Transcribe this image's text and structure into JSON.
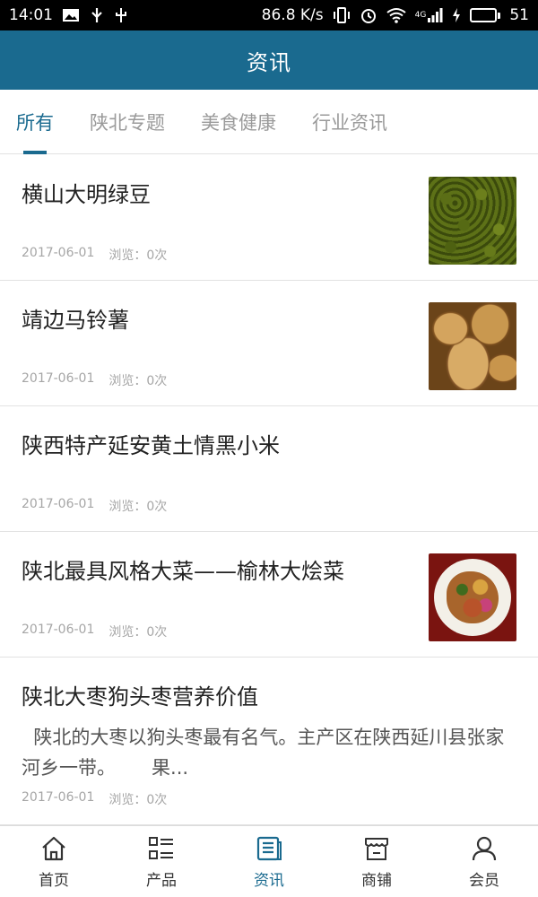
{
  "status_bar": {
    "time": "14:01",
    "speed": "86.8 K/s",
    "network": "4G",
    "battery": "51",
    "battery_level": 0.51
  },
  "header": {
    "title": "资讯"
  },
  "tabs": [
    {
      "label": "所有",
      "active": true
    },
    {
      "label": "陕北专题",
      "active": false
    },
    {
      "label": "美食健康",
      "active": false
    },
    {
      "label": "行业资讯",
      "active": false
    }
  ],
  "meta_views_label": "浏览：",
  "articles": [
    {
      "title": "横山大明绿豆",
      "date": "2017-06-01",
      "views": "浏览：0次",
      "thumb": "mung-beans"
    },
    {
      "title": "靖边马铃薯",
      "date": "2017-06-01",
      "views": "浏览：0次",
      "thumb": "potatoes"
    },
    {
      "title": "陕西特产延安黄土情黑小米",
      "date": "2017-06-01",
      "views": "浏览：0次"
    },
    {
      "title": "陕北最具风格大菜——榆林大烩菜",
      "date": "2017-06-01",
      "views": "浏览：0次",
      "thumb": "stew-dish"
    },
    {
      "title": "陕北大枣狗头枣营养价值",
      "summary": "  陕北的大枣以狗头枣最有名气。主产区在陕西延川县张家河乡一带。      果...",
      "date": "2017-06-01",
      "views": "浏览：0次"
    }
  ],
  "bottom_nav": [
    {
      "label": "首页",
      "icon": "home-icon",
      "active": false
    },
    {
      "label": "产品",
      "icon": "list-icon",
      "active": false
    },
    {
      "label": "资讯",
      "icon": "news-icon",
      "active": true
    },
    {
      "label": "商铺",
      "icon": "shop-icon",
      "active": false
    },
    {
      "label": "会员",
      "icon": "user-icon",
      "active": false
    }
  ],
  "colors": {
    "accent": "#1a6a8f",
    "status_bar": "#000000",
    "muted": "#a6a6a6"
  }
}
